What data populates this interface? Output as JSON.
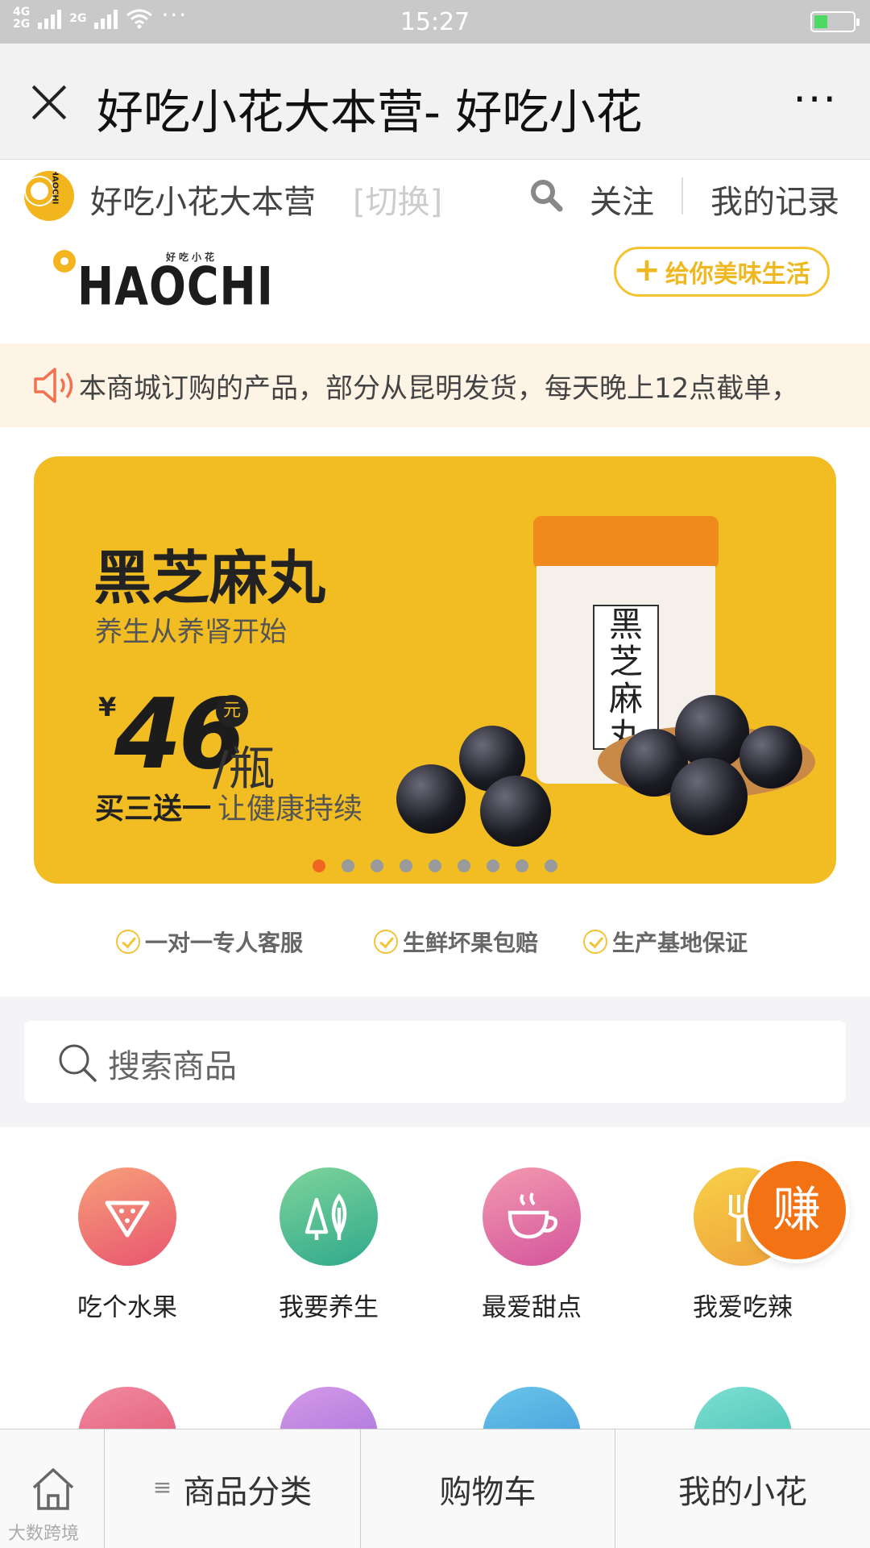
{
  "status_bar": {
    "network_top": "4G",
    "network_bottom": "2G",
    "network2": "2G",
    "more": "···",
    "time": "15:27"
  },
  "title_bar": {
    "title": "好吃小花大本营- 好吃小花",
    "more": "···"
  },
  "shop_bar": {
    "name": "好吃小花大本营",
    "switch_label": "[切换]",
    "follow_label": "关注",
    "records_label": "我的记录",
    "logo_text": "HAOCHI"
  },
  "brand": {
    "logo_small": "好吃小花",
    "logo_text": "HAOCHI",
    "slogan_button": "给你美味生活",
    "plus": "+"
  },
  "notice": {
    "text": "本商城订购的产品，部分从昆明发货，每天晚上12点截单，"
  },
  "banner": {
    "title": "黑芝麻丸",
    "subtitle": "养生从养肾开始",
    "currency": "¥",
    "price": "46",
    "unit_circle": "元",
    "unit": "/瓶",
    "promo_a": "买三送一",
    "promo_b": "让健康持续",
    "jar_label": "黑芝麻丸",
    "slide_count": 9,
    "active_slide": 1
  },
  "guarantees": [
    {
      "label": "一对一专人客服"
    },
    {
      "label": "生鲜坏果包赔"
    },
    {
      "label": "生产基地保证"
    }
  ],
  "search": {
    "placeholder": "搜索商品"
  },
  "categories": [
    {
      "label": "吃个水果",
      "icon": "watermelon-icon",
      "color": "#ee6d6d"
    },
    {
      "label": "我要养生",
      "icon": "tree-icon",
      "color": "#3cb98a"
    },
    {
      "label": "最爱甜点",
      "icon": "coffee-cup-icon",
      "color": "#ea6aa3"
    },
    {
      "label": "我爱吃辣",
      "icon": "fork-icon",
      "color": "#f2b92d"
    }
  ],
  "earn_button": {
    "label": "赚",
    "color": "#f37214"
  },
  "bottom_nav": {
    "home_icon": "home-icon",
    "categories": "商品分类",
    "cart": "购物车",
    "mine": "我的小花",
    "menu_glyph": "≡"
  },
  "watermark": "大数跨境"
}
